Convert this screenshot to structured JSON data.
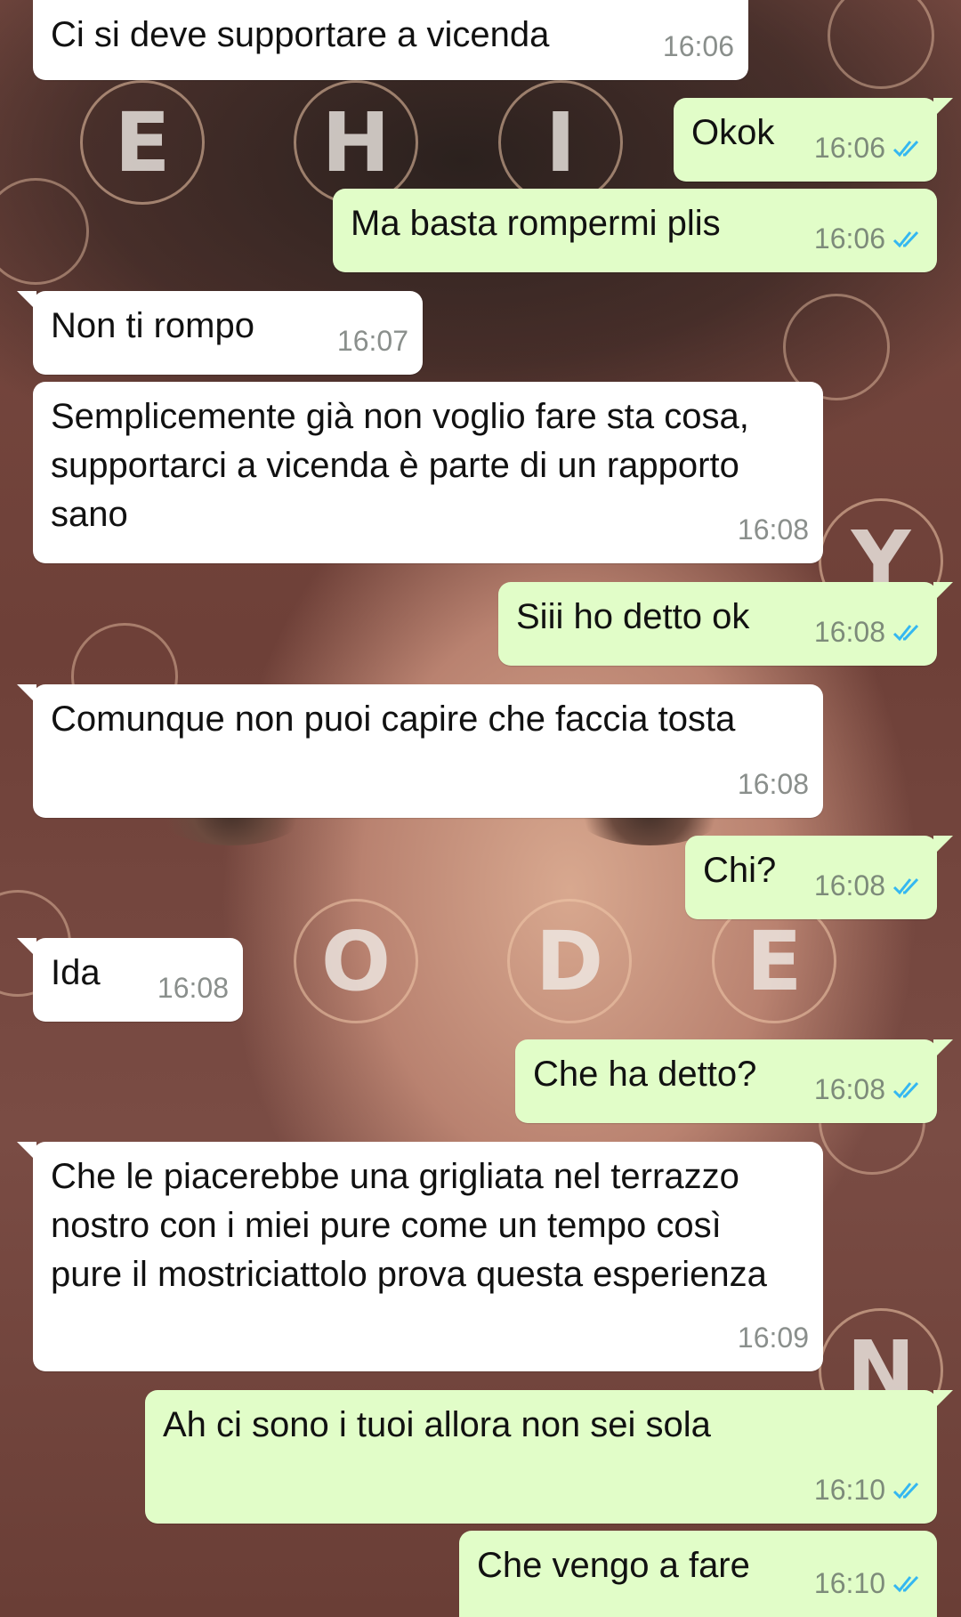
{
  "background": {
    "letters": [
      "E",
      "H",
      "I",
      "Y",
      "O",
      "D",
      "E",
      "N"
    ],
    "accent_ring": "#f0c8aa"
  },
  "colors": {
    "incoming_bubble": "#ffffff",
    "outgoing_bubble": "#e1fdc8",
    "read_tick": "#34b7f1"
  },
  "messages": [
    {
      "dir": "in",
      "text": "Ci si deve supportare a vicenda",
      "time": "16:06"
    },
    {
      "dir": "out",
      "text": "Okok",
      "time": "16:06",
      "status": "read-double-tick-icon"
    },
    {
      "dir": "out",
      "text": "Ma basta rompermi plis",
      "time": "16:06",
      "status": "read-double-tick-icon"
    },
    {
      "dir": "in",
      "text": "Non ti rompo",
      "time": "16:07"
    },
    {
      "dir": "in",
      "text": "Semplicemente già non voglio fare sta cosa, supportarci a vicenda è parte di un rapporto sano",
      "time": "16:08"
    },
    {
      "dir": "out",
      "text": "Siii ho detto ok",
      "time": "16:08",
      "status": "read-double-tick-icon"
    },
    {
      "dir": "in",
      "text": "Comunque non puoi capire che faccia tosta",
      "time": "16:08"
    },
    {
      "dir": "out",
      "text": "Chi?",
      "time": "16:08",
      "status": "read-double-tick-icon"
    },
    {
      "dir": "in",
      "text": "Ida",
      "time": "16:08"
    },
    {
      "dir": "out",
      "text": "Che ha detto?",
      "time": "16:08",
      "status": "read-double-tick-icon"
    },
    {
      "dir": "in",
      "text": "Che le piacerebbe una grigliata nel terrazzo nostro con i miei pure come un tempo così pure il mostriciattolo prova questa esperienza",
      "time": "16:09"
    },
    {
      "dir": "out",
      "text": "Ah ci sono i tuoi allora non sei sola",
      "time": "16:10",
      "status": "read-double-tick-icon"
    },
    {
      "dir": "out",
      "text": "Che vengo a fare",
      "time": "16:10",
      "status": "read-double-tick-icon"
    }
  ]
}
